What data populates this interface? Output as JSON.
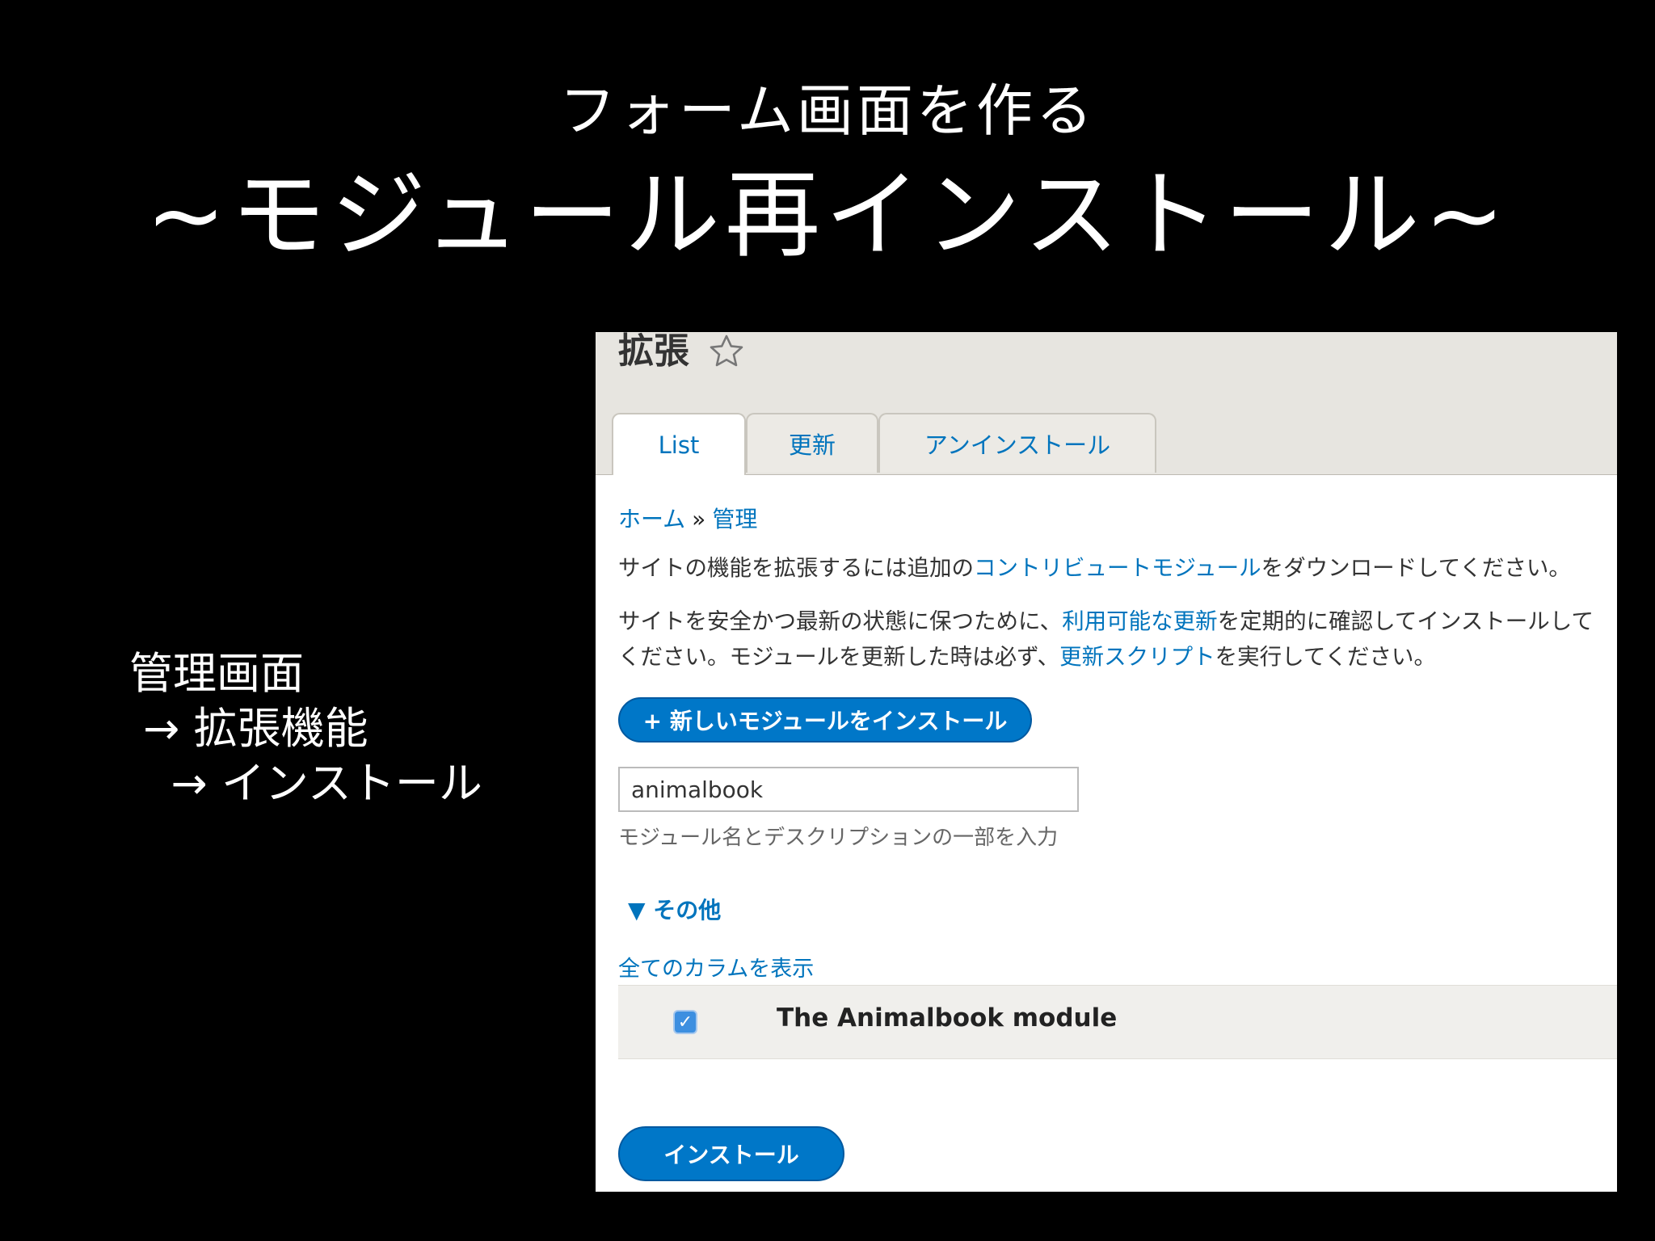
{
  "slide": {
    "subtitle": "フォーム画面を作る",
    "title": "~モジュール再インストール~",
    "notes": [
      "管理画面",
      " → 拡張機能",
      "   → インストール"
    ]
  },
  "screen": {
    "heading": "拡張",
    "tabs": [
      "List",
      "更新",
      "アンインストール"
    ],
    "breadcrumb": {
      "home": "ホーム",
      "separator": "»",
      "admin": "管理"
    },
    "desc1": {
      "before": "サイトの機能を拡張するには追加の",
      "link": "コントリビュートモジュール",
      "after": "をダウンロードしてください。"
    },
    "desc2": {
      "part1": "サイトを安全かつ最新の状態に保つために、",
      "link1": "利用可能な更新",
      "part2": "を定期的に確認してインストールしてください。モジュールを更新した時は必ず、",
      "link2": "更新スクリプト",
      "part3": "を実行してください。"
    },
    "install_new_label": "+ 新しいモジュールをインストール",
    "search": {
      "value": "animalbook",
      "help": "モジュール名とデスクリプションの一部を入力"
    },
    "details_summary": "▼ その他",
    "show_columns": "全てのカラムを表示",
    "module": {
      "name": "The Animalbook module",
      "checked": true,
      "check_glyph": "✓"
    },
    "install_label": "インストール"
  }
}
